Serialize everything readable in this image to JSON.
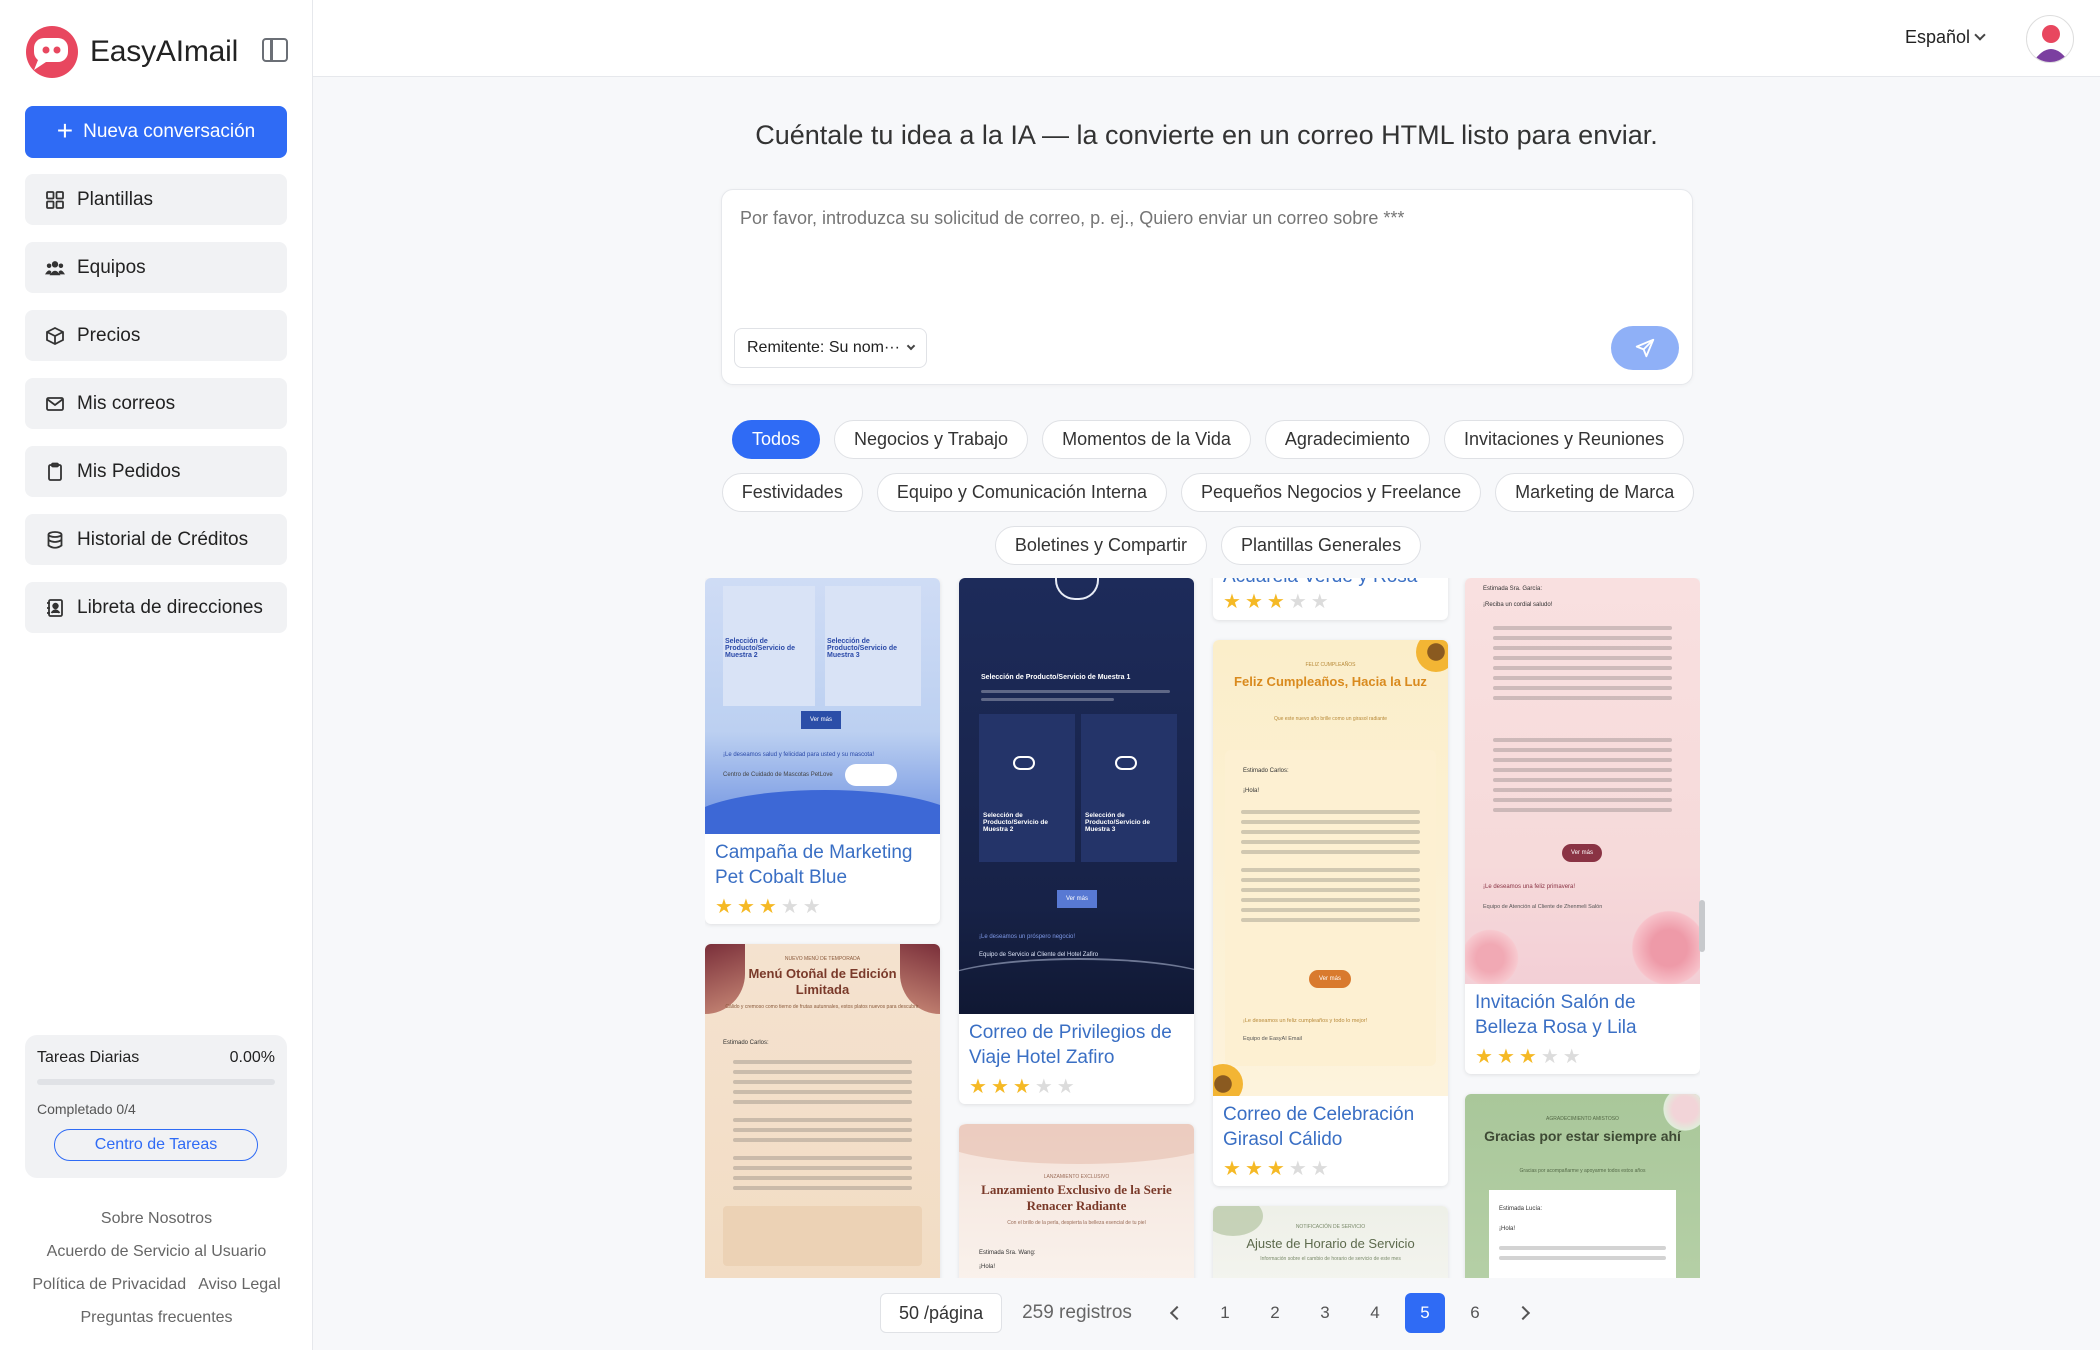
{
  "brand": {
    "name": "EasyAImail"
  },
  "sidebar": {
    "new_conversation": "Nueva conversación",
    "items": [
      {
        "label": "Plantillas",
        "icon": "grid-icon"
      },
      {
        "label": "Equipos",
        "icon": "users-icon"
      },
      {
        "label": "Precios",
        "icon": "box-icon"
      },
      {
        "label": "Mis correos",
        "icon": "mail-icon"
      },
      {
        "label": "Mis Pedidos",
        "icon": "clipboard-icon"
      },
      {
        "label": "Historial de Créditos",
        "icon": "database-icon"
      },
      {
        "label": "Libreta de direcciones",
        "icon": "contact-book-icon"
      }
    ],
    "tasks": {
      "title": "Tareas Diarias",
      "percent": "0.00%",
      "progress": 0,
      "completed": "Completado 0/4",
      "center_button": "Centro de Tareas"
    },
    "footer": {
      "about": "Sobre Nosotros",
      "terms": "Acuerdo de Servicio al Usuario",
      "privacy": "Política de Privacidad",
      "legal": "Aviso Legal",
      "faq": "Preguntas frecuentes"
    }
  },
  "header": {
    "language": "Español"
  },
  "main": {
    "headline": "Cuéntale tu idea a la IA — la convierte en un correo HTML listo para enviar.",
    "composer": {
      "placeholder": "Por favor, introduzca su solicitud de correo, p. ej., Quiero enviar un correo sobre ***",
      "sender": "Remitente: Su nom···"
    },
    "categories": [
      [
        "Todos",
        "Negocios y Trabajo",
        "Momentos de la Vida",
        "Agradecimiento",
        "Invitaciones y Reuniones"
      ],
      [
        "Festividades",
        "Equipo y Comunicación Interna",
        "Pequeños Negocios y Freelance",
        "Marketing de Marca"
      ],
      [
        "Boletines y Compartir",
        "Plantillas Generales"
      ]
    ],
    "active_category": "Todos",
    "templates": {
      "pet": {
        "title": "Campaña de Marketing Pet Cobalt Blue",
        "rating": 3,
        "thumb_title_a": "Selección de Producto/Servicio de Muestra 2",
        "thumb_title_b": "Selección de Producto/Servicio de Muestra 3",
        "thumb_button": "Ver más",
        "thumb_wish": "¡Le deseamos salud y felicidad para usted y su mascota!",
        "thumb_sign": "Centro de Cuidado de Mascotas PetLove"
      },
      "autumn": {
        "eyebrow": "NUEVO MENÚ DE TEMPORADA",
        "thumb_title": "Menú Otoñal de Edición Limitada",
        "thumb_sub": "Cálido y cremoso como tierno de frutas autunnales, estos platos nuevos para descubrir.",
        "greeting": "Estimado Carlos:"
      },
      "zafiro": {
        "title": "Correo de Privilegios de Viaje Hotel Zafiro",
        "rating": 3,
        "thumb_title_1": "Selección de Producto/Servicio de Muestra 1",
        "thumb_title_2": "Selección de Producto/Servicio de Muestra 2",
        "thumb_title_3": "Selección de Producto/Servicio de Muestra 3",
        "thumb_button": "Ver más",
        "thumb_wish": "¡Le deseamos un próspero negocio!",
        "thumb_sign": "Equipo de Servicio al Cliente del Hotel Zafiro"
      },
      "pearl": {
        "eyebrow": "LANZAMIENTO EXCLUSIVO",
        "thumb_title": "Lanzamiento Exclusivo de la Serie Renacer Radiante",
        "thumb_sub": "Con el brillo de la perla, despierta la belleza esencial de tu piel",
        "greeting": "Estimada Sra. Wang:",
        "hello": "¡Hola!"
      },
      "watercolor": {
        "title_fragment": "Acuarela Verde y Rosa",
        "rating": 3
      },
      "sunflower": {
        "title": "Correo de Celebración Girasol Cálido",
        "rating": 3,
        "eyebrow": "FELIZ CUMPLEAÑOS",
        "thumb_title": "Feliz Cumpleaños, Hacia la Luz",
        "thumb_sub": "Que este nuevo año brille como un girasol radiante",
        "greeting": "Estimado Carlos:",
        "hello": "¡Hola!",
        "thumb_button": "Ver más",
        "thumb_wish": "¡Le deseamos un feliz cumpleaños y todo lo mejor!",
        "thumb_sign": "Equipo de EasyAI Email"
      },
      "schedule": {
        "eyebrow": "NOTIFICACIÓN DE SERVICIO",
        "thumb_title": "Ajuste de Horario de Servicio",
        "thumb_sub": "Información sobre el cambio de horario de servicio de este mes"
      },
      "salon": {
        "title": "Invitación Salón de Belleza Rosa y Lila",
        "rating": 3,
        "greeting": "Estimada Sra. García:",
        "hello": "¡Reciba un cordial saludo!",
        "thumb_button": "Ver más",
        "thumb_wish": "¡Le deseamos una feliz primavera!",
        "thumb_sign": "Equipo de Atención al Cliente de Zhenmeli Salón"
      },
      "thanks": {
        "eyebrow": "AGRADECIMIENTO AMISTOSO",
        "thumb_title": "Gracias por estar siempre ahí",
        "thumb_sub": "Gracias por acompañarme y apoyarme todos estos años",
        "greeting": "Estimada Lucía:",
        "hello": "¡Hola!"
      }
    }
  },
  "pagination": {
    "per_page": "50 /página",
    "total": "259 registros",
    "pages": [
      "1",
      "2",
      "3",
      "4",
      "5",
      "6"
    ],
    "current": "5"
  },
  "colors": {
    "accent": "#2f6bf5",
    "star": "#f5b925"
  }
}
